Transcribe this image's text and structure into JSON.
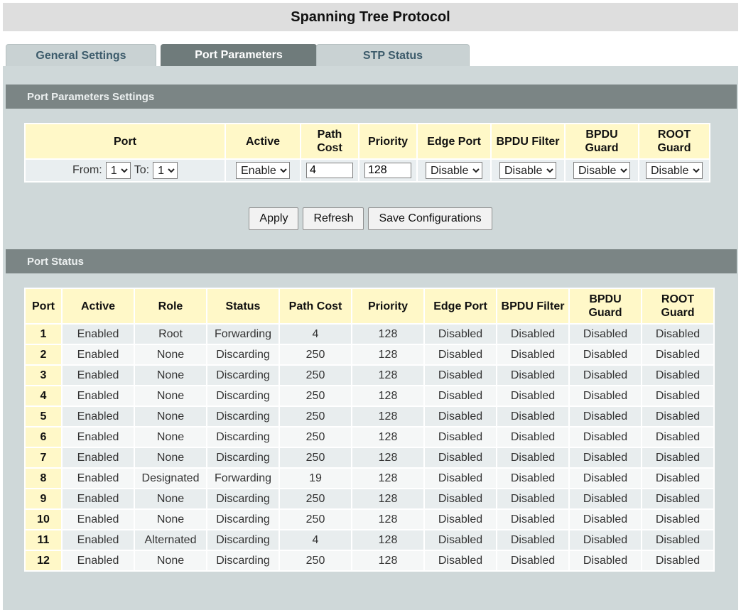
{
  "title": "Spanning Tree Protocol",
  "tabs": [
    {
      "label": "General Settings",
      "active": false
    },
    {
      "label": "Port Parameters",
      "active": true
    },
    {
      "label": "STP Status",
      "active": false
    }
  ],
  "settings": {
    "header": "Port Parameters Settings",
    "columns": [
      "Port",
      "Active",
      "Path Cost",
      "Priority",
      "Edge Port",
      "BPDU Filter",
      "BPDU Guard",
      "ROOT Guard"
    ],
    "from_label": "From:",
    "to_label": "To:",
    "from_value": "1",
    "to_value": "1",
    "active_value": "Enable",
    "path_cost_value": "4",
    "priority_value": "128",
    "edge_port_value": "Disable",
    "bpdu_filter_value": "Disable",
    "bpdu_guard_value": "Disable",
    "root_guard_value": "Disable"
  },
  "buttons": {
    "apply": "Apply",
    "refresh": "Refresh",
    "save": "Save Configurations"
  },
  "status": {
    "header": "Port Status",
    "columns": [
      "Port",
      "Active",
      "Role",
      "Status",
      "Path Cost",
      "Priority",
      "Edge Port",
      "BPDU Filter",
      "BPDU Guard",
      "ROOT Guard"
    ],
    "rows": [
      [
        "1",
        "Enabled",
        "Root",
        "Forwarding",
        "4",
        "128",
        "Disabled",
        "Disabled",
        "Disabled",
        "Disabled"
      ],
      [
        "2",
        "Enabled",
        "None",
        "Discarding",
        "250",
        "128",
        "Disabled",
        "Disabled",
        "Disabled",
        "Disabled"
      ],
      [
        "3",
        "Enabled",
        "None",
        "Discarding",
        "250",
        "128",
        "Disabled",
        "Disabled",
        "Disabled",
        "Disabled"
      ],
      [
        "4",
        "Enabled",
        "None",
        "Discarding",
        "250",
        "128",
        "Disabled",
        "Disabled",
        "Disabled",
        "Disabled"
      ],
      [
        "5",
        "Enabled",
        "None",
        "Discarding",
        "250",
        "128",
        "Disabled",
        "Disabled",
        "Disabled",
        "Disabled"
      ],
      [
        "6",
        "Enabled",
        "None",
        "Discarding",
        "250",
        "128",
        "Disabled",
        "Disabled",
        "Disabled",
        "Disabled"
      ],
      [
        "7",
        "Enabled",
        "None",
        "Discarding",
        "250",
        "128",
        "Disabled",
        "Disabled",
        "Disabled",
        "Disabled"
      ],
      [
        "8",
        "Enabled",
        "Designated",
        "Forwarding",
        "19",
        "128",
        "Disabled",
        "Disabled",
        "Disabled",
        "Disabled"
      ],
      [
        "9",
        "Enabled",
        "None",
        "Discarding",
        "250",
        "128",
        "Disabled",
        "Disabled",
        "Disabled",
        "Disabled"
      ],
      [
        "10",
        "Enabled",
        "None",
        "Discarding",
        "250",
        "128",
        "Disabled",
        "Disabled",
        "Disabled",
        "Disabled"
      ],
      [
        "11",
        "Enabled",
        "Alternated",
        "Discarding",
        "4",
        "128",
        "Disabled",
        "Disabled",
        "Disabled",
        "Disabled"
      ],
      [
        "12",
        "Enabled",
        "None",
        "Discarding",
        "250",
        "128",
        "Disabled",
        "Disabled",
        "Disabled",
        "Disabled"
      ]
    ]
  }
}
